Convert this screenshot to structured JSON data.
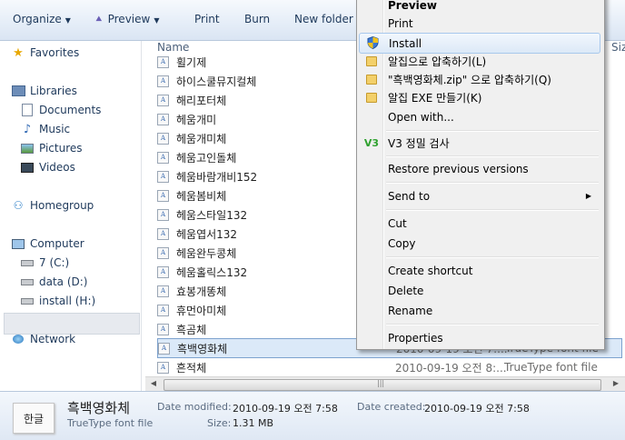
{
  "toolbar": {
    "organize": "Organize",
    "preview": "Preview",
    "print": "Print",
    "burn": "Burn",
    "new_folder": "New folder"
  },
  "nav": {
    "favorites": "Favorites",
    "libraries": "Libraries",
    "documents": "Documents",
    "music": "Music",
    "pictures": "Pictures",
    "videos": "Videos",
    "homegroup": "Homegroup",
    "computer": "Computer",
    "drive_c": "7 (C:)",
    "drive_d": "data (D:)",
    "drive_h": "install (H:)",
    "network": "Network"
  },
  "list": {
    "col_name": "Name",
    "col_size_partial": "Siz",
    "rows": [
      {
        "name": "휠기제",
        "date": "",
        "type": ""
      },
      {
        "name": "하이스쿨뮤지컬체",
        "date": "",
        "type": ""
      },
      {
        "name": "해리포터체",
        "date": "",
        "type": ""
      },
      {
        "name": "헤움개미",
        "date": "",
        "type": ""
      },
      {
        "name": "헤움개미체",
        "date": "",
        "type": ""
      },
      {
        "name": "헤움고인돌체",
        "date": "",
        "type": ""
      },
      {
        "name": "헤움바람개비152",
        "date": "",
        "type": ""
      },
      {
        "name": "헤움봄비체",
        "date": "",
        "type": ""
      },
      {
        "name": "헤움스타일132",
        "date": "",
        "type": ""
      },
      {
        "name": "헤움엽서132",
        "date": "",
        "type": ""
      },
      {
        "name": "헤움완두콩체",
        "date": "",
        "type": ""
      },
      {
        "name": "헤움홀릭스132",
        "date": "",
        "type": ""
      },
      {
        "name": "효봉개똥체",
        "date": "",
        "type": ""
      },
      {
        "name": "휴먼아미체",
        "date": "",
        "type": ""
      },
      {
        "name": "흑곰체",
        "date": "",
        "type": ""
      },
      {
        "name": "흑백영화체",
        "date": "2010-09-19 오전 7:...",
        "type": "TrueType font file"
      },
      {
        "name": "흔적체",
        "date": "2010-09-19 오전 8:...",
        "type": "TrueType font file"
      }
    ]
  },
  "details": {
    "thumb_text": "한글",
    "name": "흑백영화체",
    "type": "TrueType font file",
    "modified_label": "Date modified:",
    "modified_value": "2010-09-19 오전 7:58",
    "created_label": "Date created:",
    "created_value": "2010-09-19 오전 7:58",
    "size_label": "Size:",
    "size_value": "1.31 MB"
  },
  "menu": {
    "preview": "Preview",
    "print": "Print",
    "install": "Install",
    "alzip_compress": "알집으로 압축하기(L)",
    "alzip_zip": "\"흑백영화체.zip\" 으로 압축하기(Q)",
    "alzip_exe": "알집 EXE 만들기(K)",
    "open_with": "Open with...",
    "v3_scan": "V3 정밀 검사",
    "restore": "Restore previous versions",
    "send_to": "Send to",
    "cut": "Cut",
    "copy": "Copy",
    "create_shortcut": "Create shortcut",
    "delete": "Delete",
    "rename": "Rename",
    "properties": "Properties"
  },
  "colors": {
    "accent": "#1e395b",
    "selection": "#dbe9f8",
    "menu_bg": "#f0f0f0"
  }
}
